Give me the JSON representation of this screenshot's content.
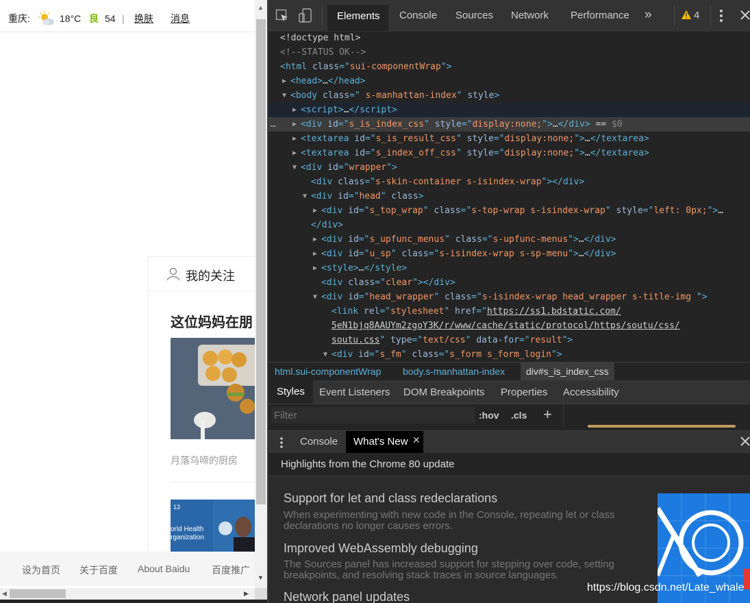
{
  "page": {
    "topbar": {
      "city": "重庆:",
      "temperature": "18°C",
      "aqi_label": "良",
      "aqi_value": "54",
      "separator": "|",
      "skin_link": "换肤",
      "message_link": "消息"
    },
    "card": {
      "header_title": "我的关注",
      "headline": "这位妈妈在朋",
      "author": "月落乌啼的厨房",
      "thumb2_text_1": "13",
      "thumb2_text_2": "orld Health",
      "thumb2_text_3": "rganization"
    },
    "footer": {
      "links": [
        "设为首页",
        "关于百度",
        "About Baidu",
        "百度推广"
      ]
    },
    "colors": {
      "aqi_green": "#7ab800"
    }
  },
  "devtools": {
    "tabs": [
      "Elements",
      "Console",
      "Sources",
      "Network",
      "Performance"
    ],
    "more_tabs": "»",
    "warning_count": "4",
    "dom_lines": [
      {
        "indent": 0,
        "tri": "",
        "html": "<span class='tx'>&lt;!doctype html&gt;</span>"
      },
      {
        "indent": 0,
        "tri": "",
        "html": "<span class='ct'>&lt;!--STATUS OK--&gt;</span>"
      },
      {
        "indent": 0,
        "tri": "",
        "html": "<span class='tg'>&lt;html </span><span class='an'>class</span><span class='tg'>=\"</span><span class='av'>sui-componentWrap</span><span class='tg'>\"&gt;</span>"
      },
      {
        "indent": 1,
        "tri": "▶",
        "html": "<span class='tg'>&lt;head&gt;</span><span class='tx'>…</span><span class='tg'>&lt;/head&gt;</span>"
      },
      {
        "indent": 1,
        "tri": "▼",
        "html": "<span class='tg'>&lt;body </span><span class='an'>class</span><span class='tg'>=\"</span><span class='av'> s-manhattan-index</span><span class='tg'>\" </span><span class='an'>style</span><span class='tg'>&gt;</span>"
      },
      {
        "indent": 2,
        "tri": "▶",
        "html": "<span class='tg'>&lt;script&gt;</span><span class='tx'>…</span><span class='tg'>&lt;/script&gt;</span>"
      },
      {
        "indent": 2,
        "tri": "▶",
        "html": "<span class='tg'>&lt;div </span><span class='an'>id</span><span class='tg'>=\"</span><span class='av'>s_is_index_css</span><span class='tg'>\" </span><span class='an'>style</span><span class='tg'>=\"</span><span class='av'>display:none;</span><span class='tg'>\"&gt;</span><span class='tx'>…</span><span class='tg'>&lt;/div&gt;</span><span class='tx'> == </span><span class='ct'>$0</span>"
      },
      {
        "indent": 2,
        "tri": "▶",
        "html": "<span class='tg'>&lt;textarea </span><span class='an'>id</span><span class='tg'>=\"</span><span class='av'>s_is_result_css</span><span class='tg'>\" </span><span class='an'>style</span><span class='tg'>=\"</span><span class='av'>display:none;</span><span class='tg'>\"&gt;</span><span class='tx'>…</span><span class='tg'>&lt;/textarea&gt;</span>"
      },
      {
        "indent": 2,
        "tri": "▶",
        "html": "<span class='tg'>&lt;textarea </span><span class='an'>id</span><span class='tg'>=\"</span><span class='av'>s_index_off_css</span><span class='tg'>\" </span><span class='an'>style</span><span class='tg'>=\"</span><span class='av'>display:none;</span><span class='tg'>\"&gt;</span><span class='tx'>…</span><span class='tg'>&lt;/textarea&gt;</span>"
      },
      {
        "indent": 2,
        "tri": "▼",
        "html": "<span class='tg'>&lt;div </span><span class='an'>id</span><span class='tg'>=\"</span><span class='av'>wrapper</span><span class='tg'>\"&gt;</span>"
      },
      {
        "indent": 3,
        "tri": "",
        "html": "<span class='tg'>&lt;div </span><span class='an'>class</span><span class='tg'>=\"</span><span class='av'>s-skin-container s-isindex-wrap</span><span class='tg'>\"&gt;&lt;/div&gt;</span>"
      },
      {
        "indent": 3,
        "tri": "▼",
        "html": "<span class='tg'>&lt;div </span><span class='an'>id</span><span class='tg'>=\"</span><span class='av'>head</span><span class='tg'>\" </span><span class='an'>class</span><span class='tg'>&gt;</span>"
      },
      {
        "indent": 4,
        "tri": "▶",
        "html": "<span class='tg'>&lt;div </span><span class='an'>id</span><span class='tg'>=\"</span><span class='av'>s_top_wrap</span><span class='tg'>\" </span><span class='an'>class</span><span class='tg'>=\"</span><span class='av'>s-top-wrap s-isindex-wrap</span><span class='tg'>\" </span><span class='an'>style</span><span class='tg'>=\"</span><span class='av'>left: 0px;</span><span class='tg'>\"&gt;</span><span class='tx'>…</span>"
      },
      {
        "indent": 3,
        "tri": "",
        "html": "<span class='tg'>&lt;/div&gt;</span>"
      },
      {
        "indent": 4,
        "tri": "▶",
        "html": "<span class='tg'>&lt;div </span><span class='an'>id</span><span class='tg'>=\"</span><span class='av'>s_upfunc_menus</span><span class='tg'>\" </span><span class='an'>class</span><span class='tg'>=\"</span><span class='av'>s-upfunc-menus</span><span class='tg'>\"&gt;</span><span class='tx'>…</span><span class='tg'>&lt;/div&gt;</span>"
      },
      {
        "indent": 4,
        "tri": "▶",
        "html": "<span class='tg'>&lt;div </span><span class='an'>id</span><span class='tg'>=\"</span><span class='av'>u_sp</span><span class='tg'>\" </span><span class='an'>class</span><span class='tg'>=\"</span><span class='av'>s-isindex-wrap s-sp-menu</span><span class='tg'>\"&gt;</span><span class='tx'>…</span><span class='tg'>&lt;/div&gt;</span>"
      },
      {
        "indent": 4,
        "tri": "▶",
        "html": "<span class='tg'>&lt;style&gt;</span><span class='tx'>…</span><span class='tg'>&lt;/style&gt;</span>"
      },
      {
        "indent": 4,
        "tri": "",
        "html": "<span class='tg'>&lt;div </span><span class='an'>class</span><span class='tg'>=\"</span><span class='av'>clear</span><span class='tg'>\"&gt;&lt;/div&gt;</span>"
      },
      {
        "indent": 4,
        "tri": "▼",
        "html": "<span class='tg'>&lt;div </span><span class='an'>id</span><span class='tg'>=\"</span><span class='av'>head_wrapper</span><span class='tg'>\" </span><span class='an'>class</span><span class='tg'>=\"</span><span class='av'>s-isindex-wrap head_wrapper s-title-img </span><span class='tg'>\"&gt;</span>"
      },
      {
        "indent": 5,
        "tri": "",
        "html": "<span class='tg'>&lt;link </span><span class='an'>rel</span><span class='tg'>=\"</span><span class='av'>stylesheet</span><span class='tg'>\" </span><span class='an'>href</span><span class='tg'>=\"</span><span class='tx ul'>https://ss1.bdstatic.com/</span>"
      },
      {
        "indent": 5,
        "tri": "",
        "html": "<span class='tx ul'>5eN1bjq8AAUYm2zgoY3K/r/www/cache/static/protocol/https/soutu/css/</span>"
      },
      {
        "indent": 5,
        "tri": "",
        "html": "<span class='tx ul'>soutu.css</span><span class='tg'>\" </span><span class='an'>type</span><span class='tg'>=\"</span><span class='av'>text/css</span><span class='tg'>\" </span><span class='an'>data-for</span><span class='tg'>=\"</span><span class='av'>result</span><span class='tg'>\"&gt;</span>"
      },
      {
        "indent": 5,
        "tri": "▼",
        "html": "<span class='tg'>&lt;div </span><span class='an'>id</span><span class='tg'>=\"</span><span class='av'>s_fm</span><span class='tg'>\" </span><span class='an'>class</span><span class='tg'>=\"</span><span class='av'>s_form s_form_login</span><span class='tg'>\"&gt;</span>"
      }
    ],
    "breadcrumbs": [
      "html.sui-componentWrap",
      "body.s-manhattan-index",
      "div#s_is_index_css"
    ],
    "styles_tabs": [
      "Styles",
      "Event Listeners",
      "DOM Breakpoints",
      "Properties",
      "Accessibility"
    ],
    "filter_placeholder": "Filter",
    "hov_label": ":hov",
    "cls_label": ".cls",
    "add_label": "+",
    "drawer_tabs": [
      "Console",
      "What's New"
    ],
    "whats_new_header": "Highlights from the Chrome 80 update",
    "news": [
      {
        "title": "Support for let and class redeclarations",
        "desc": "When experimenting with new code in the Console, repeating let or class declarations no longer causes errors."
      },
      {
        "title": "Improved WebAssembly debugging",
        "desc": "The Sources panel has increased support for stepping over code, setting breakpoints, and resolving stack traces in source languages."
      },
      {
        "title": "Network panel updates",
        "desc": ""
      }
    ],
    "watermark": "https://blog.csdn.net/Late_whale",
    "colors": {
      "accent": "#1c7ae0",
      "selected_row": "#3c3c3c",
      "tag": "#5db0d7",
      "attr_value": "#f29766"
    }
  }
}
